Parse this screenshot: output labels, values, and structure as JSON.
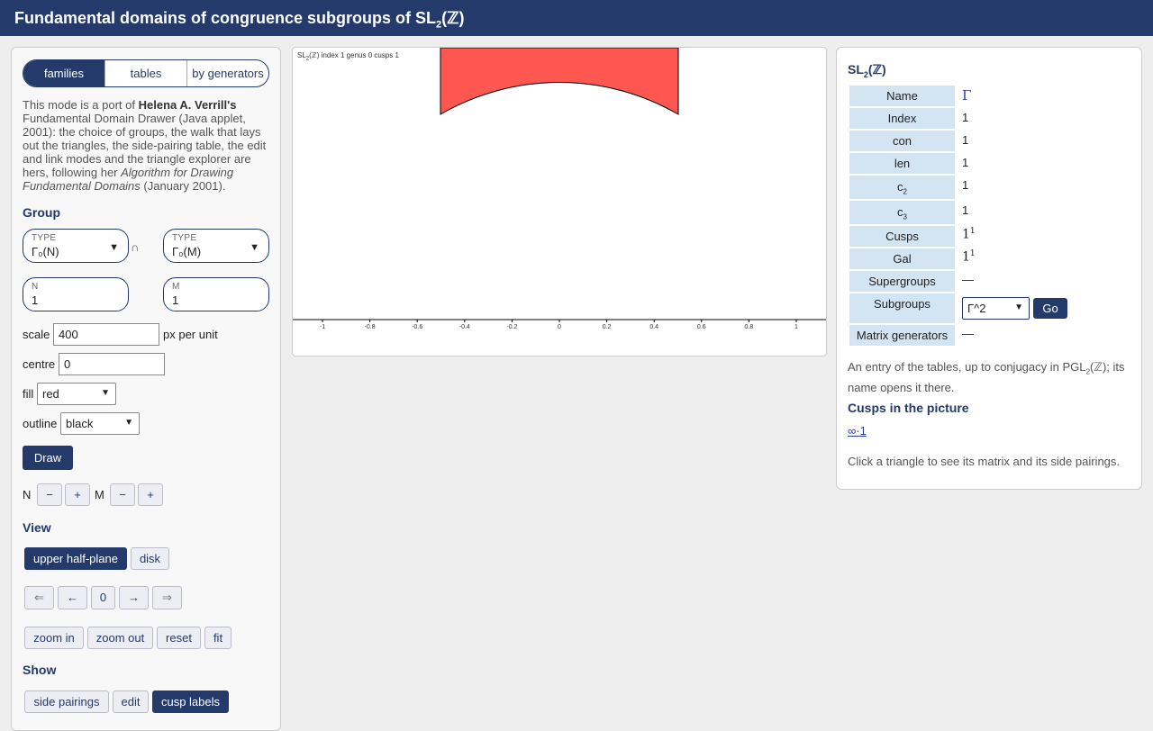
{
  "header": {
    "title_prefix": "Fundamental domains of congruence subgroups of SL",
    "title_sub": "2",
    "title_suffix": "(ℤ)"
  },
  "modes": {
    "tabs": [
      {
        "label": "families",
        "active": true
      },
      {
        "label": "tables",
        "active": false
      },
      {
        "label": "by generators",
        "active": false
      }
    ]
  },
  "intro": {
    "t1": "This mode is a port of ",
    "author": "Helena A. Verrill's",
    "t2": " Fundamental Domain Drawer (Java applet, 2001): the choice of groups, the walk that lays out the triangles, the side-pairing table, the edit and link modes and the triangle explorer are hers, following her ",
    "work": "Algorithm for Drawing Fundamental Domains",
    "t3": " (January 2001)."
  },
  "group": {
    "heading": "Group",
    "type_label": "TYPE",
    "type1": "Γ₀(N)",
    "type2": "Γ₀(M)",
    "cap_symbol": "∩",
    "n_label": "N",
    "n_value": "1",
    "m_label": "M",
    "m_value": "1"
  },
  "controls": {
    "scale_label": "scale",
    "scale_value": "400",
    "scale_unit": "px per unit",
    "centre_label": "centre",
    "centre_value": "0",
    "fill_label": "fill",
    "fill_value": "red",
    "outline_label": "outline",
    "outline_value": "black",
    "draw_label": "Draw",
    "n_step_label": "N",
    "m_step_label": "M",
    "minus": "−",
    "plus": "+"
  },
  "view": {
    "heading": "View",
    "upper_label": "upper half-plane",
    "disk_label": "disk",
    "nav_first": "⇐",
    "nav_prev": "←",
    "nav_value": "0",
    "nav_next": "→",
    "nav_last": "⇒",
    "zoom_in": "zoom in",
    "zoom_out": "zoom out",
    "reset": "reset",
    "fit": "fit"
  },
  "show": {
    "heading": "Show",
    "side_pairings": "side pairings",
    "edit": "edit",
    "cusp_labels": "cusp labels"
  },
  "canvas": {
    "caption_a": "SL",
    "caption_sub": "2",
    "caption_b": "(ℤ) index 1 genus 0 cusps 1",
    "fill_color": "#fe5752",
    "outline_color": "#000000",
    "ticks": [
      "-1",
      "-0.8",
      "-0.6",
      "-0.4",
      "-0.2",
      "0",
      "0.2",
      "0.4",
      "0.6",
      "0.8",
      "1"
    ]
  },
  "info": {
    "title_a": "SL",
    "title_sub": "2",
    "title_b": "(ℤ)",
    "name_label": "Name",
    "name_value": "Γ",
    "index_label": "Index",
    "index_value": "1",
    "con_label": "con",
    "con_value": "1",
    "len_label": "len",
    "len_value": "1",
    "c2_label_a": "c",
    "c2_label_sub": "2",
    "c2_value": "1",
    "c3_label_a": "c",
    "c3_label_sub": "3",
    "c3_value": "1",
    "cusps_label": "Cusps",
    "cusps_base": "1",
    "cusps_exp": "1",
    "gal_label": "Gal",
    "gal_base": "1",
    "gal_exp": "1",
    "supergroups_label": "Supergroups",
    "supergroups_value": "—",
    "subgroups_label": "Subgroups",
    "subgroups_select": "Γ^2",
    "go_label": "Go",
    "matrix_label": "Matrix generators",
    "matrix_value": "—",
    "note_a": "An entry of the tables, up to conjugacy in PGL",
    "note_sub": "2",
    "note_b": "(ℤ); its name opens it there.",
    "cusps_heading": "Cusps in the picture",
    "cusp_link": "∞·1",
    "click_note": "Click a triangle to see its matrix and its side pairings."
  }
}
